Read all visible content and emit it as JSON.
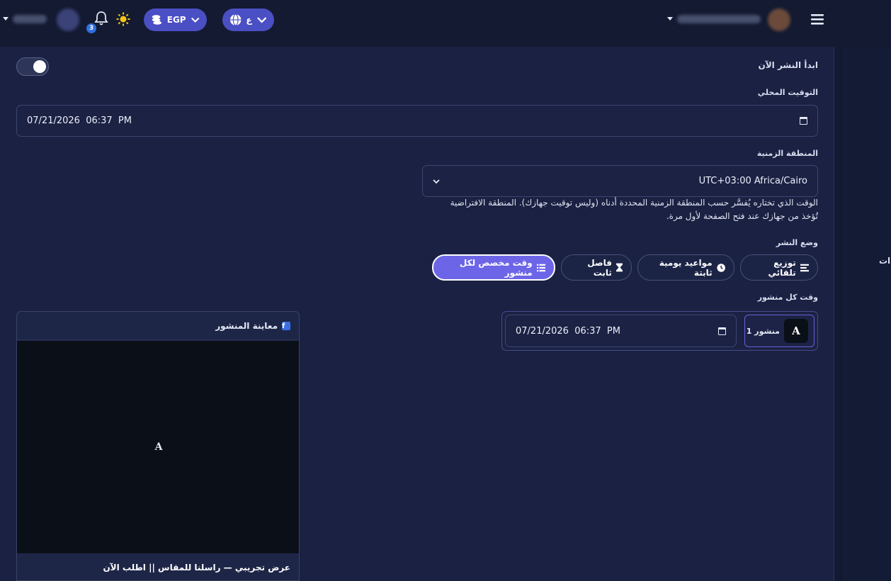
{
  "topbar": {
    "currency": "EGP",
    "language": "ع",
    "notifications_count": "3"
  },
  "form": {
    "publish_now_label": "ابدأ النشر الآن",
    "local_time_label": "التوقيت المحلي",
    "local_time_value": "07/21/2026  06:37  PM",
    "timezone_label": "المنطقة الزمنية",
    "timezone_value": "UTC+03:00 Africa/Cairo",
    "timezone_help_line1": "الوقت الذي تختاره يُفسَّر حسب المنطقة الزمنية المحددة أدناه (وليس توقيت جهازك). المنطقة الافتراضية",
    "timezone_help_line2": "تُؤخذ من جهازك عند فتح الصفحة لأول مرة.",
    "publish_mode_label": "وضع النشر",
    "modes": [
      {
        "label": "توزيع تلقائي",
        "icon": "bars-icon"
      },
      {
        "label": "مواعيد يومية ثابتة",
        "icon": "clock-icon"
      },
      {
        "label": "فاصل ثابت",
        "icon": "hourglass-icon"
      },
      {
        "label": "وقت مخصص لكل منشور",
        "icon": "list-icon",
        "active": true
      }
    ],
    "per_post_time_label": "وقت كل منشور",
    "posts": [
      {
        "avatar_letter": "A",
        "name": "منشور 1",
        "time_value": "07/21/2026  06:37  PM"
      }
    ]
  },
  "preview": {
    "title": "معاينة المنشور",
    "media_letter": "A",
    "caption": "عرض تجريبي — راسلنا للمقاس || اطلب الآن"
  },
  "colors": {
    "accent": "#6d65e8",
    "pill": "#4b4fc4",
    "background": "#141a33",
    "panel": "#1a2142"
  }
}
